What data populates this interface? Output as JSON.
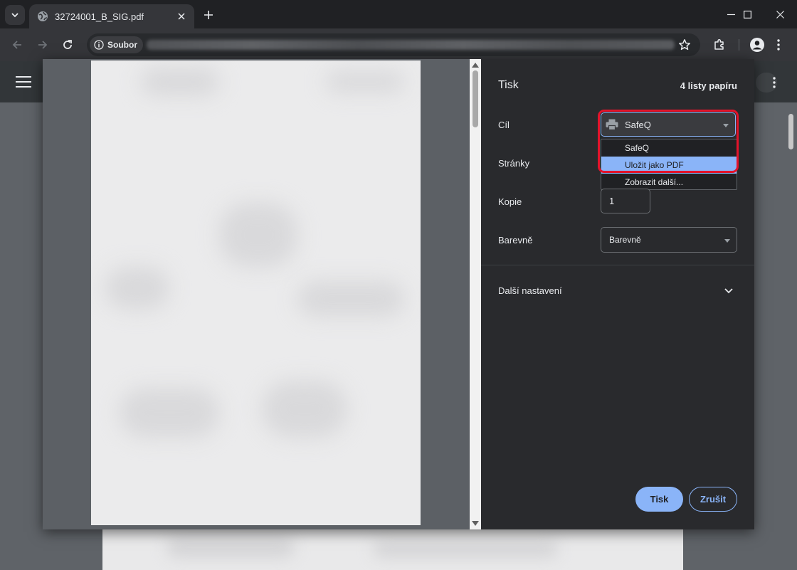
{
  "browser": {
    "tab_title": "32724001_B_SIG.pdf",
    "site_chip_label": "Soubor"
  },
  "print_dialog": {
    "title": "Tisk",
    "sheet_count": "4 listy papíru",
    "destination": {
      "label": "Cíl",
      "value": "SafeQ",
      "options": [
        {
          "label": "SafeQ",
          "selected": false
        },
        {
          "label": "Uložit jako PDF",
          "selected": true
        },
        {
          "label": "Zobrazit další...",
          "selected": false
        }
      ]
    },
    "pages": {
      "label": "Stránky"
    },
    "copies": {
      "label": "Kopie",
      "value": "1"
    },
    "color": {
      "label": "Barevně",
      "value": "Barevně"
    },
    "more_settings": {
      "label": "Další nastavení"
    },
    "buttons": {
      "print": "Tisk",
      "cancel": "Zrušit"
    }
  },
  "colors": {
    "accent": "#8ab4f8",
    "highlight": "#e3132b",
    "sidebar_bg": "#292a2d"
  }
}
